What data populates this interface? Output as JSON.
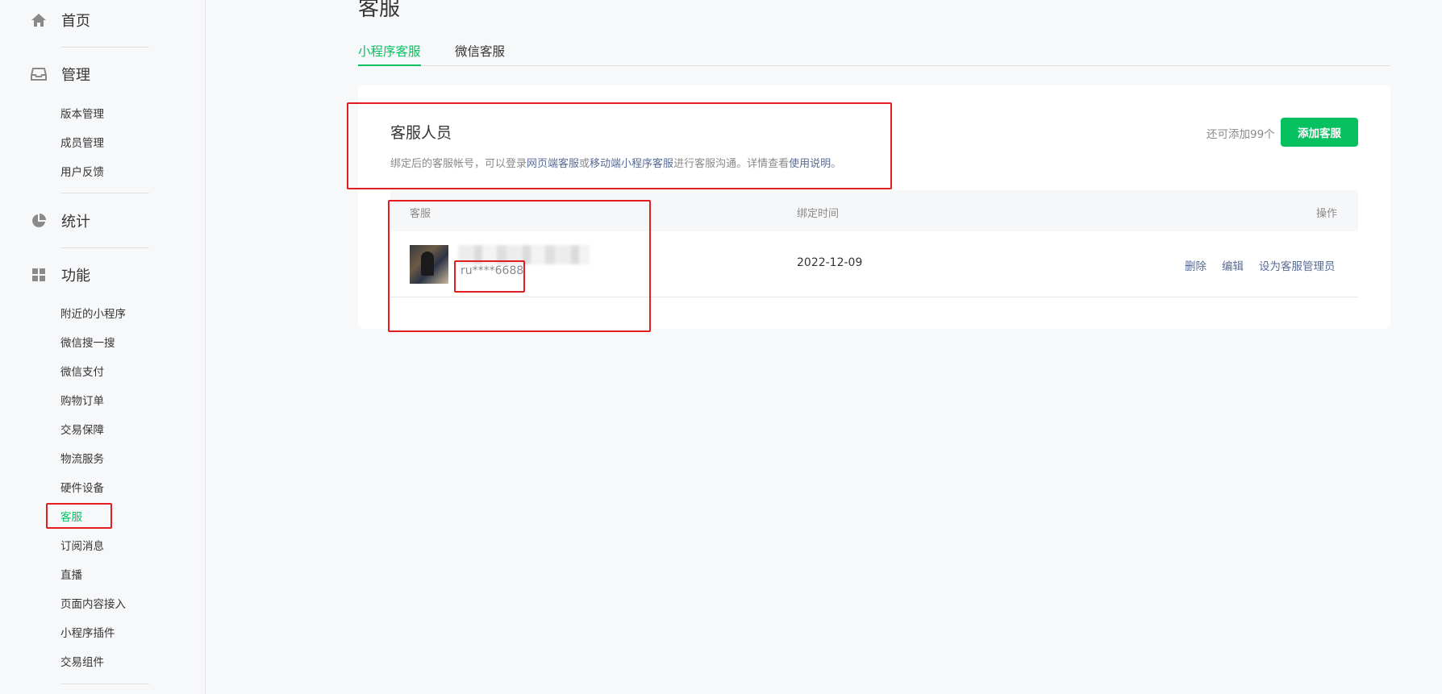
{
  "sidebar": {
    "home": "首页",
    "manage": "管理",
    "manage_items": [
      "版本管理",
      "成员管理",
      "用户反馈"
    ],
    "stats": "统计",
    "features": "功能",
    "feature_items": [
      "附近的小程序",
      "微信搜一搜",
      "微信支付",
      "购物订单",
      "交易保障",
      "物流服务",
      "硬件设备",
      "客服",
      "订阅消息",
      "直播",
      "页面内容接入",
      "小程序插件",
      "交易组件"
    ],
    "active_item": "客服"
  },
  "page": {
    "title": "客服",
    "tabs": [
      "小程序客服",
      "微信客服"
    ]
  },
  "section": {
    "title": "客服人员",
    "desc_prefix": "绑定后的客服帐号，可以登录",
    "link_web": "网页端客服",
    "desc_or": "或",
    "link_mobile": "移动端小程序客服",
    "desc_mid": "进行客服沟通。详情查看",
    "link_help": "使用说明",
    "desc_end": "。",
    "quota": "还可添加99个",
    "add_button": "添加客服"
  },
  "table": {
    "headers": [
      "客服",
      "绑定时间",
      "操作"
    ],
    "rows": [
      {
        "account": "ru****6688",
        "bind_time": "2022-12-09",
        "actions": [
          "删除",
          "编辑",
          "设为客服管理员"
        ]
      }
    ]
  },
  "colors": {
    "accent": "#07c160",
    "link": "#576b95",
    "annotation": "#e41e1e"
  }
}
